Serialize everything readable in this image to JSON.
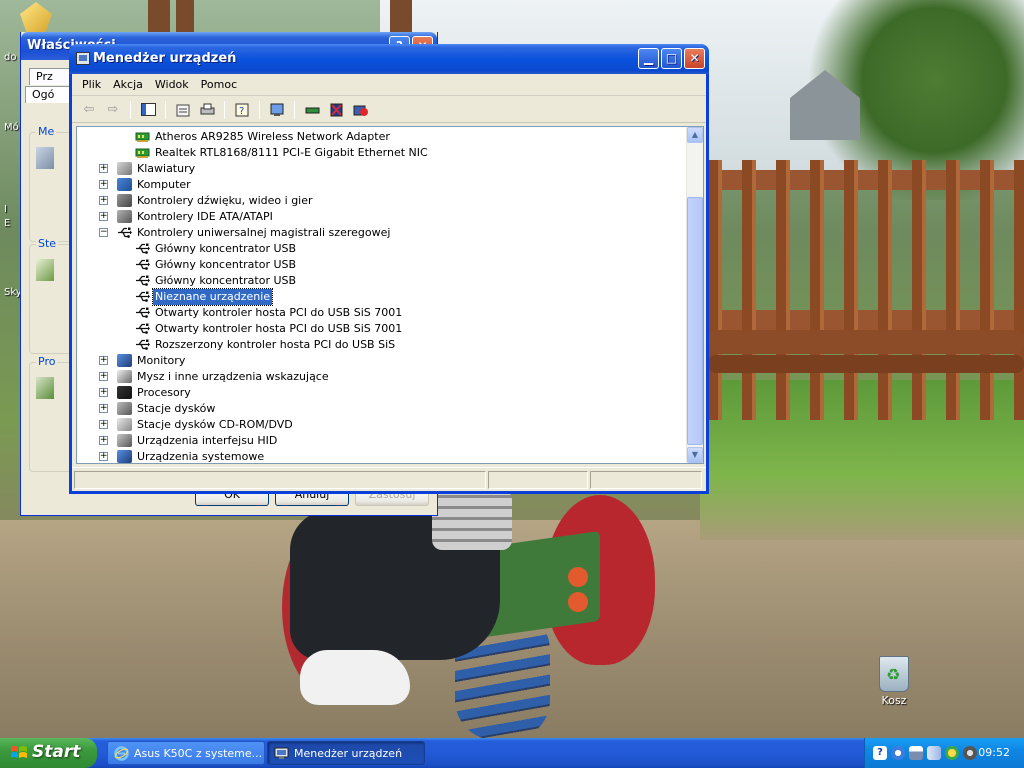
{
  "desktop": {
    "recycle_bin_label": "Kosz",
    "side_labels": [
      "do",
      "Mó",
      "I",
      "E",
      "Sky"
    ]
  },
  "back_window": {
    "title": "Właściwości",
    "tabs": [
      "Prz",
      "Ogó"
    ],
    "groups": [
      "Me",
      "Ste",
      "Pro"
    ],
    "buttons": {
      "ok": "OK",
      "cancel": "Anuluj",
      "apply": "Zastosuj"
    }
  },
  "main_window": {
    "title": "Menedżer urządzeń",
    "menu": [
      "Plik",
      "Akcja",
      "Widok",
      "Pomoc"
    ],
    "toolbar_icons": [
      "back-arrow-icon",
      "forward-arrow-icon",
      "console-tree-icon",
      "properties-icon",
      "print-icon",
      "help-icon",
      "scan-hardware-icon",
      "update-driver-icon",
      "uninstall-icon",
      "disable-icon"
    ],
    "tree": [
      {
        "label": "Atheros AR9285 Wireless Network Adapter",
        "level": 2,
        "icon": "network-card-icon",
        "expander": ""
      },
      {
        "label": "Realtek RTL8168/8111 PCI-E Gigabit Ethernet NIC",
        "level": 2,
        "icon": "network-card-icon",
        "expander": ""
      },
      {
        "label": "Klawiatury",
        "level": 1,
        "icon": "keyboard-icon",
        "expander": "+"
      },
      {
        "label": "Komputer",
        "level": 1,
        "icon": "computer-icon",
        "expander": "+"
      },
      {
        "label": "Kontrolery dźwięku, wideo i gier",
        "level": 1,
        "icon": "sound-icon",
        "expander": "+"
      },
      {
        "label": "Kontrolery IDE ATA/ATAPI",
        "level": 1,
        "icon": "ide-controller-icon",
        "expander": "+"
      },
      {
        "label": "Kontrolery uniwersalnej magistrali szeregowej",
        "level": 1,
        "icon": "usb-icon",
        "expander": "−"
      },
      {
        "label": "Główny koncentrator USB",
        "level": 2,
        "icon": "usb-icon",
        "expander": ""
      },
      {
        "label": "Główny koncentrator USB",
        "level": 2,
        "icon": "usb-icon",
        "expander": ""
      },
      {
        "label": "Główny koncentrator USB",
        "level": 2,
        "icon": "usb-icon",
        "expander": ""
      },
      {
        "label": "Nieznane urządzenie",
        "level": 2,
        "icon": "usb-icon",
        "expander": "",
        "selected": true
      },
      {
        "label": "Otwarty kontroler hosta PCI do USB SiS 7001",
        "level": 2,
        "icon": "usb-icon",
        "expander": ""
      },
      {
        "label": "Otwarty kontroler hosta PCI do USB SiS 7001",
        "level": 2,
        "icon": "usb-icon",
        "expander": ""
      },
      {
        "label": "Rozszerzony kontroler hosta PCI do USB SiS",
        "level": 2,
        "icon": "usb-icon",
        "expander": ""
      },
      {
        "label": "Monitory",
        "level": 1,
        "icon": "monitor-icon",
        "expander": "+"
      },
      {
        "label": "Mysz i inne urządzenia wskazujące",
        "level": 1,
        "icon": "mouse-icon",
        "expander": "+"
      },
      {
        "label": "Procesory",
        "level": 1,
        "icon": "processor-icon",
        "expander": "+"
      },
      {
        "label": "Stacje dysków",
        "level": 1,
        "icon": "disk-drive-icon",
        "expander": "+"
      },
      {
        "label": "Stacje dysków CD-ROM/DVD",
        "level": 1,
        "icon": "cdrom-icon",
        "expander": "+"
      },
      {
        "label": "Urządzenia interfejsu HID",
        "level": 1,
        "icon": "hid-icon",
        "expander": "+"
      },
      {
        "label": "Urządzenia systemowe",
        "level": 1,
        "icon": "system-devices-icon",
        "expander": "+"
      }
    ]
  },
  "taskbar": {
    "start_label": "Start",
    "tasks": [
      {
        "label": "Asus K50C z systeme...",
        "icon": "internet-explorer-icon"
      },
      {
        "label": "Menedżer urządzeń",
        "icon": "device-manager-icon"
      }
    ],
    "tray_icons": [
      "help-tray-icon",
      "network-tray-icon",
      "usb-tray-icon",
      "wireless-tray-icon",
      "security-tray-icon",
      "volume-tray-icon"
    ],
    "clock": "09:52"
  },
  "colors": {
    "xp_blue": "#0a52dd",
    "selection": "#316ac5",
    "start_green": "#3c9a3e",
    "tray_blue": "#0f87e4"
  }
}
